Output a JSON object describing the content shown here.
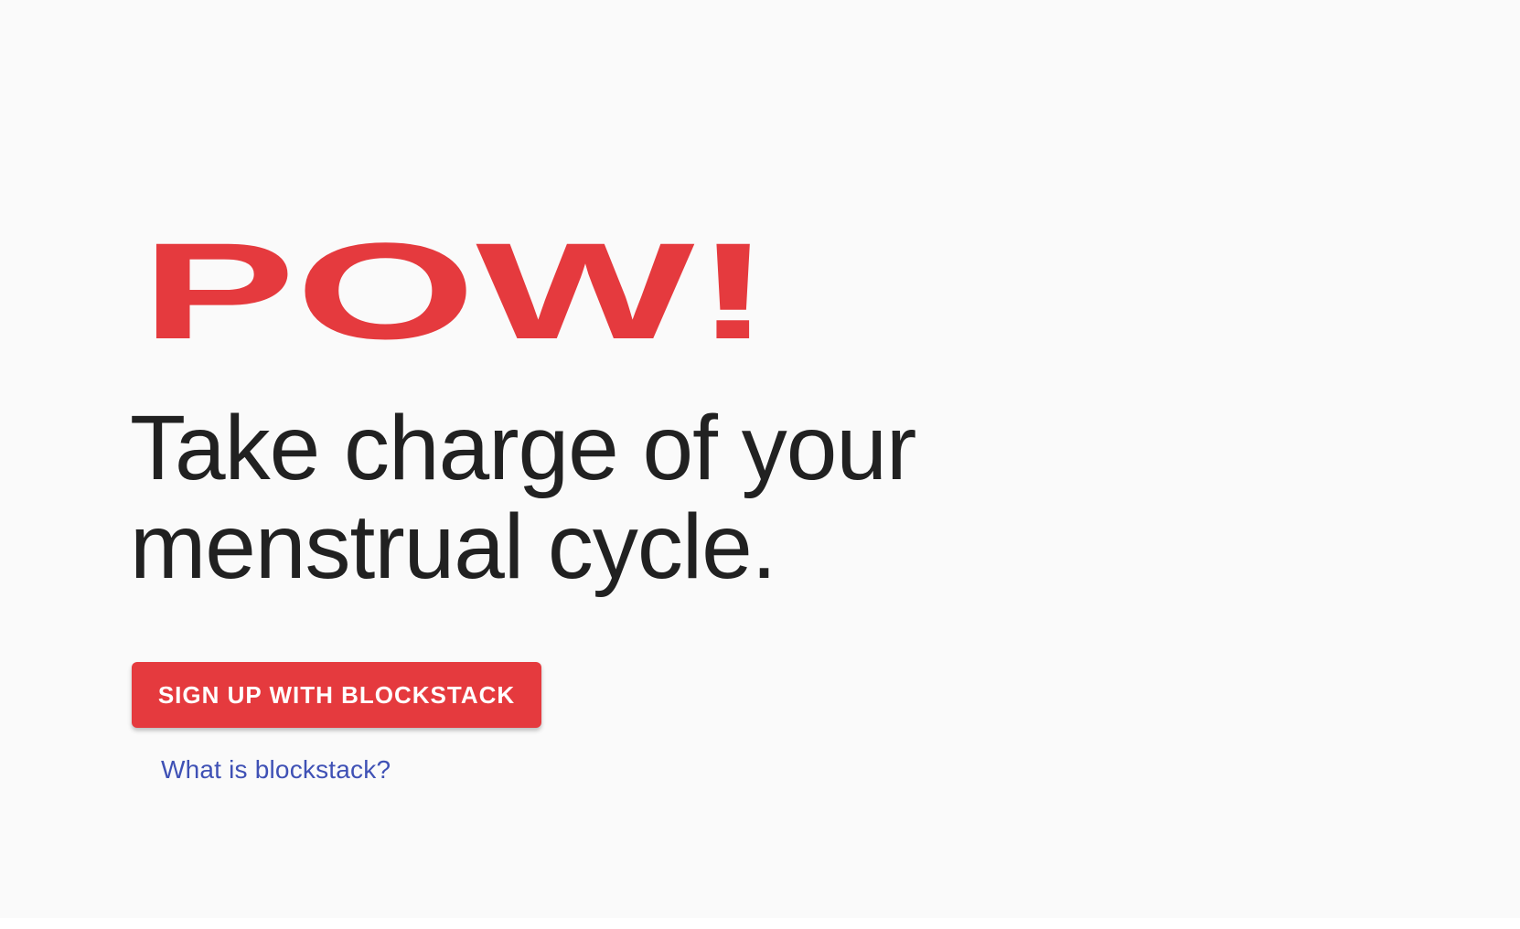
{
  "app": {
    "title": "POW!"
  },
  "hero": {
    "headline_line1": "Take charge of your",
    "headline_line2": "menstrual cycle."
  },
  "actions": {
    "signup_label": "SIGN UP WITH BLOCKSTACK",
    "help_link_label": "What is blockstack?"
  },
  "colors": {
    "brand_red": "#e53a3e",
    "text_dark": "#212121",
    "link_blue": "#3f51b5",
    "background": "#fafafa"
  },
  "icons": {
    "logo": "pow-logo"
  }
}
